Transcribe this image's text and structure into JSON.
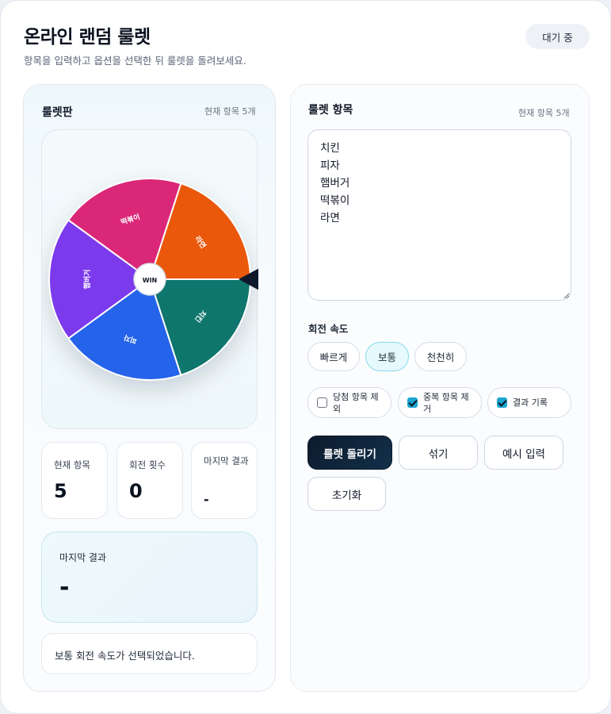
{
  "header": {
    "title": "온라인 랜덤 룰렛",
    "subtitle": "항목을 입력하고 옵션을 선택한 뒤 룰렛을 돌려보세요.",
    "status": "대기 중"
  },
  "wheel_panel": {
    "title": "룰렛판",
    "count_text": "현재 항목 5개",
    "center_label": "WIN",
    "segments": [
      {
        "label": "라면",
        "color": "#ea580c"
      },
      {
        "label": "치킨",
        "color": "#0f766e"
      },
      {
        "label": "피자",
        "color": "#2563eb"
      },
      {
        "label": "햄버거",
        "color": "#7c3aed"
      },
      {
        "label": "떡볶이",
        "color": "#db2777"
      }
    ],
    "pointer_color": "#0f172a"
  },
  "stats": {
    "items": {
      "label": "현재 항목",
      "value": "5"
    },
    "spins": {
      "label": "회전 횟수",
      "value": "0"
    },
    "last": {
      "label": "마지막 결과",
      "value": "-"
    }
  },
  "result": {
    "label": "마지막 결과",
    "value": "-"
  },
  "message": "보통 회전 속도가 선택되었습니다.",
  "items_panel": {
    "title": "룰렛 항목",
    "count_text": "현재 항목 5개",
    "items_text": "치킨\n피자\n햄버거\n떡볶이\n라면"
  },
  "speed": {
    "label": "회전 속도",
    "options": [
      "빠르게",
      "보통",
      "천천히"
    ],
    "selected": "보통"
  },
  "options": [
    {
      "label": "당첨 항목 제외",
      "checked": false
    },
    {
      "label": "중복 항목 제거",
      "checked": true
    },
    {
      "label": "결과 기록",
      "checked": true
    }
  ],
  "actions": {
    "spin": "룰렛 돌리기",
    "shuffle": "섞기",
    "example": "예시 입력",
    "reset": "초기화"
  },
  "colors": {
    "accent": "#19a5cf",
    "primary_button": "#0d1b2e"
  }
}
